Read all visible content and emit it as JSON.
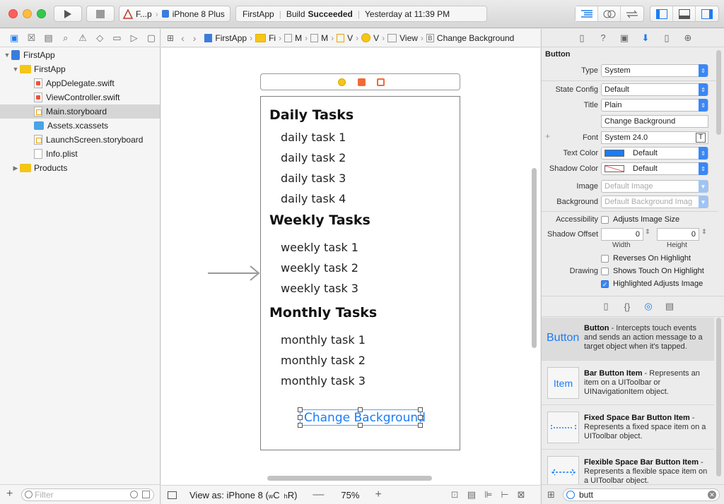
{
  "toolbar": {
    "scheme": "F...p",
    "device": "iPhone 8 Plus",
    "status_app": "FirstApp",
    "status_build_prefix": "Build",
    "status_build_result": "Succeeded",
    "status_time": "Yesterday at 11:39 PM"
  },
  "navigator": {
    "items": [
      {
        "label": "FirstApp"
      },
      {
        "label": "FirstApp"
      },
      {
        "label": "AppDelegate.swift"
      },
      {
        "label": "ViewController.swift"
      },
      {
        "label": "Main.storyboard"
      },
      {
        "label": "Assets.xcassets"
      },
      {
        "label": "LaunchScreen.storyboard"
      },
      {
        "label": "Info.plist"
      },
      {
        "label": "Products"
      }
    ],
    "filter_placeholder": "Filter"
  },
  "jumpbar": {
    "crumbs": [
      "FirstApp",
      "Fi",
      "M",
      "M",
      "V",
      "V",
      "View",
      "Change Background"
    ]
  },
  "scene": {
    "headings": [
      "Daily Tasks",
      "Weekly Tasks",
      "Monthly Tasks"
    ],
    "daily": [
      "daily task 1",
      "daily task 2",
      "daily task 3",
      "daily task 4"
    ],
    "weekly": [
      "weekly task 1",
      "weekly task 2",
      "weekly task 3"
    ],
    "monthly": [
      "monthly task 1",
      "monthly task 2",
      "monthly task 3"
    ],
    "button_label": "Change Background"
  },
  "editor_footer": {
    "view_as_prefix": "View as: iPhone 8 (",
    "w_compact": "w",
    "c_label": "C",
    "h_regular": "h",
    "r_label": "R)",
    "zoom": "75%"
  },
  "inspector": {
    "section_title": "Button",
    "type_label": "Type",
    "type_value": "System",
    "state_label": "State Config",
    "state_value": "Default",
    "title_label": "Title",
    "title_value": "Plain",
    "title_text": "Change Background",
    "font_label": "Font",
    "font_value": "System 24.0",
    "text_color_label": "Text Color",
    "text_color_value": "Default",
    "shadow_color_label": "Shadow Color",
    "shadow_color_value": "Default",
    "image_label": "Image",
    "image_placeholder": "Default Image",
    "background_label": "Background",
    "background_placeholder": "Default Background Imag",
    "accessibility_label": "Accessibility",
    "adjusts_image_size": "Adjusts Image Size",
    "shadow_offset_label": "Shadow Offset",
    "width_value": "0",
    "height_value": "0",
    "width_label": "Width",
    "height_label": "Height",
    "reverses": "Reverses On Highlight",
    "drawing_label": "Drawing",
    "shows_touch": "Shows Touch On Highlight",
    "highlighted_adjusts": "Highlighted Adjusts Image",
    "text_color_hex": "#1a7cf7"
  },
  "library": {
    "items": [
      {
        "icon_text": "Button",
        "name": "Button",
        "desc": " - Intercepts touch events and sends an action message to a target object when it's tapped."
      },
      {
        "icon_text": "Item",
        "name": "Bar Button Item",
        "desc": " - Represents an item on a UIToolbar or UINavigationItem object."
      },
      {
        "icon_text": "",
        "name": "Fixed Space Bar Button Item",
        "desc": " - Represents a fixed space item on a UIToolbar object."
      },
      {
        "icon_text": "",
        "name": "Flexible Space Bar Button Item",
        "desc": " - Represents a flexible space item on a UIToolbar object."
      }
    ],
    "search_value": "butt"
  }
}
